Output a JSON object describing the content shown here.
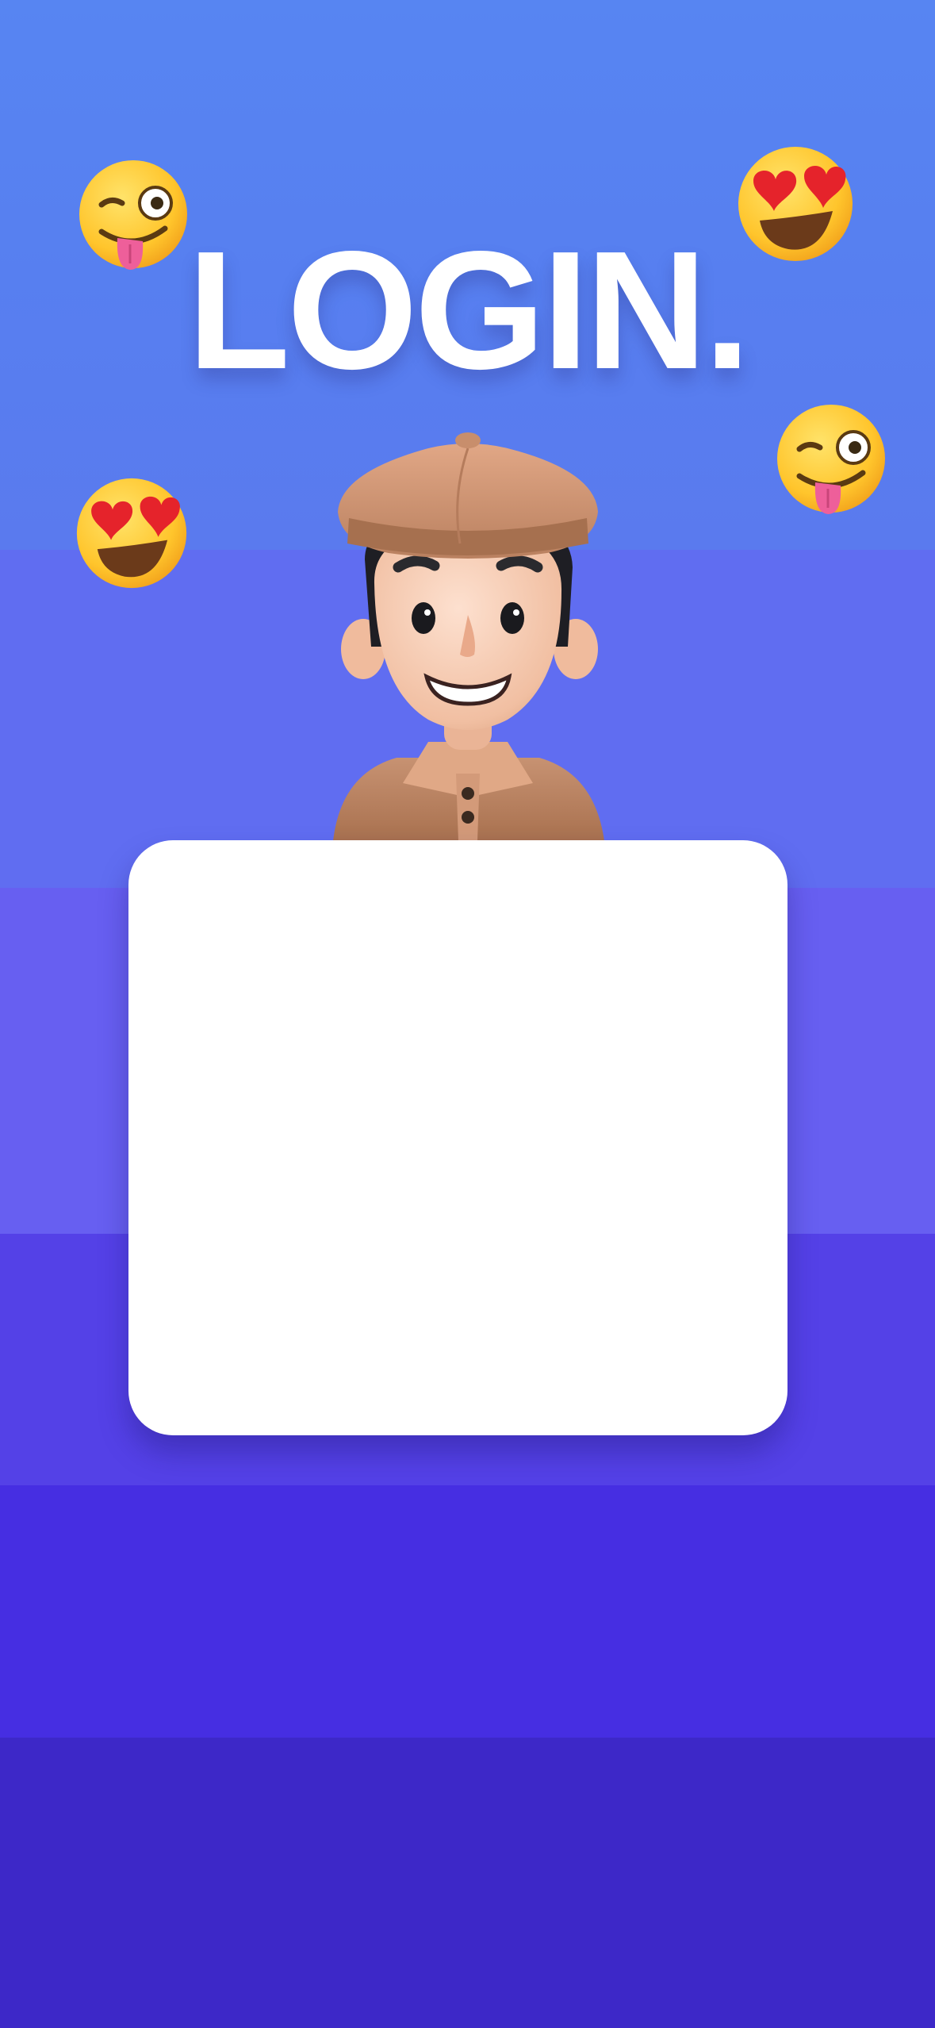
{
  "screen": {
    "title": "LOGIN."
  },
  "decorations": {
    "emoji_top_left": "winking-tongue-emoji",
    "emoji_top_right": "heart-eyes-emoji",
    "emoji_mid_right": "winking-tongue-emoji",
    "emoji_mid_left": "heart-eyes-emoji",
    "avatar": "boy-in-flat-cap-3d-avatar"
  },
  "colors": {
    "title": "#ffffff",
    "card": "#ffffff",
    "band_top": "#5785f2",
    "band_bottom": "#3d28c8"
  },
  "login_card": {}
}
